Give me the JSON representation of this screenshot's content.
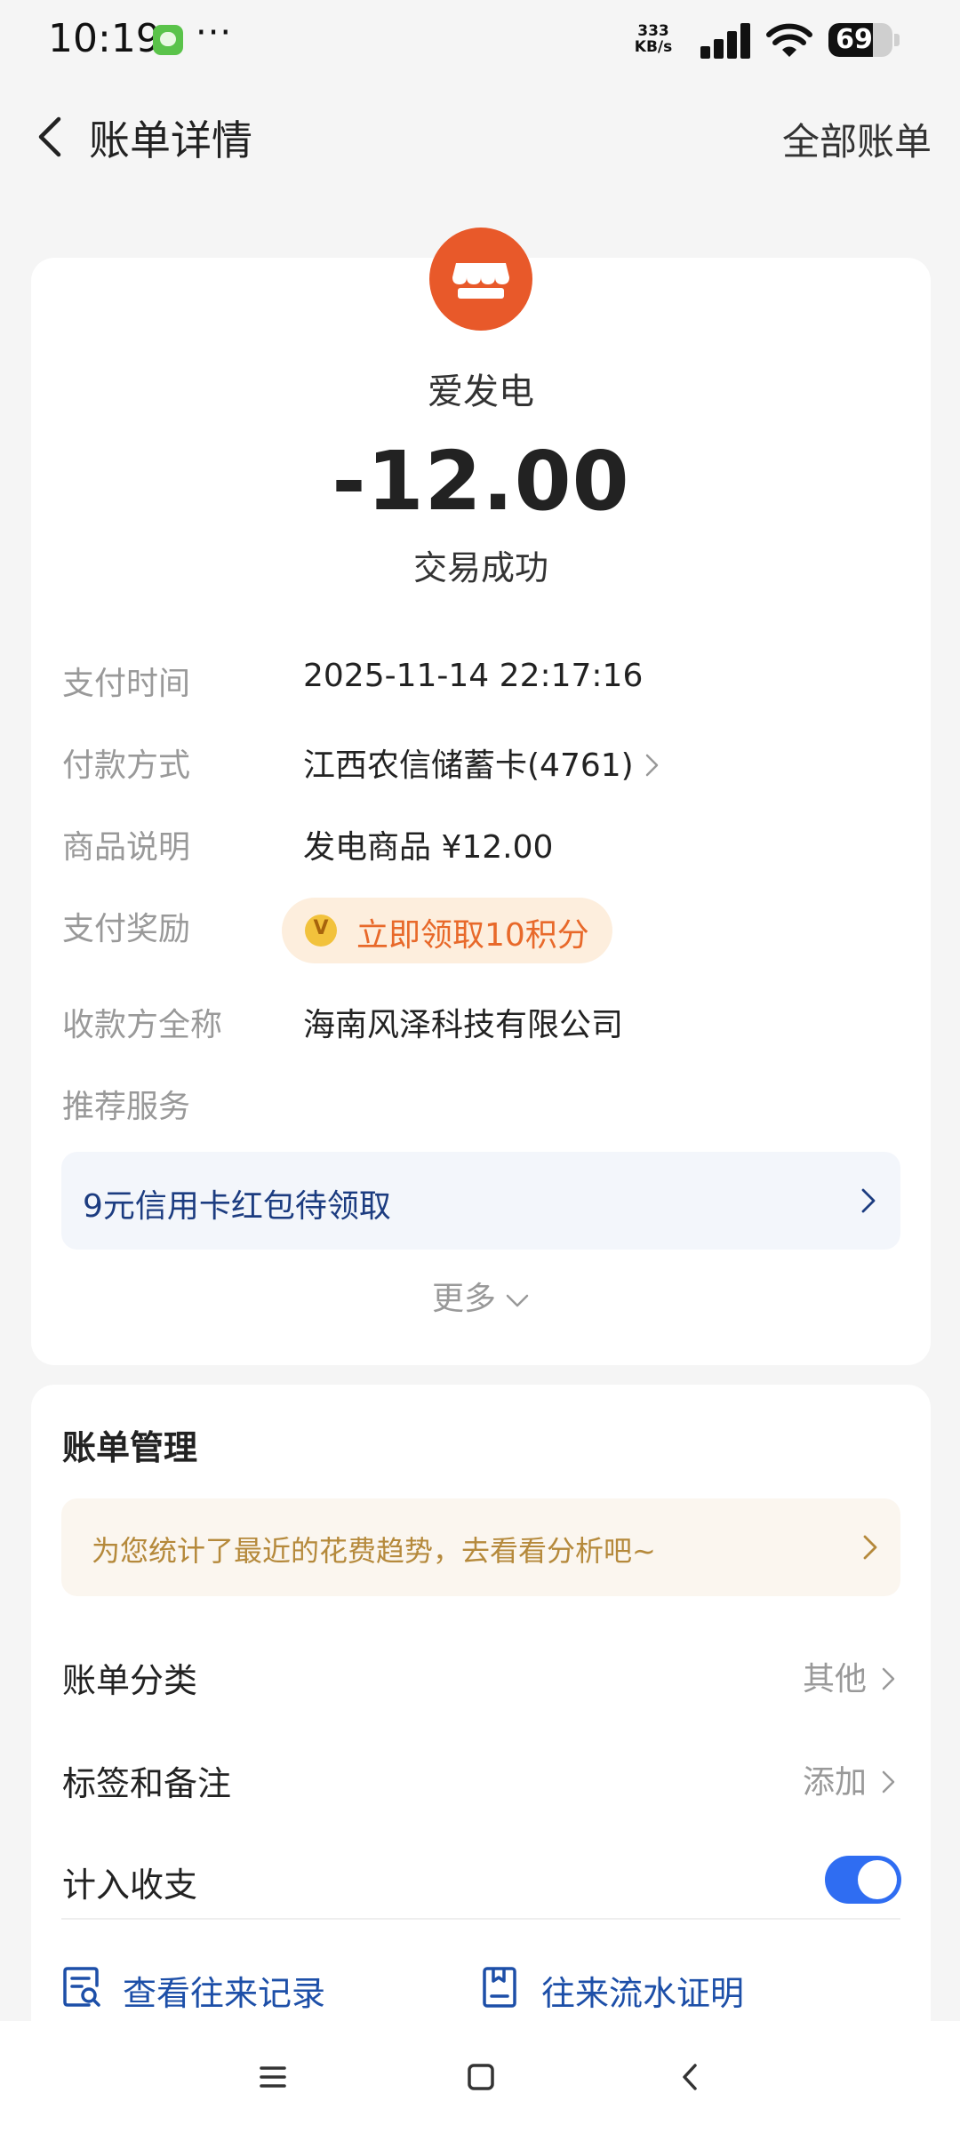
{
  "status_bar": {
    "time": "10:19",
    "network_speed_value": "333",
    "network_speed_unit": "KB/s",
    "battery": "69",
    "battery_level": 0.69
  },
  "nav": {
    "title": "账单详情",
    "right_action": "全部账单"
  },
  "transaction": {
    "merchant": "爱发电",
    "amount": "-12.00",
    "status": "交易成功",
    "details": [
      {
        "label": "支付时间",
        "value": "2025-11-14 22:17:16"
      },
      {
        "label": "付款方式",
        "value": "江西农信储蓄卡(4761)"
      },
      {
        "label": "商品说明",
        "value": "发电商品 ¥12.00"
      },
      {
        "label": "支付奖励",
        "value": "立即领取10积分"
      },
      {
        "label": "收款方全称",
        "value": "海南风泽科技有限公司"
      },
      {
        "label": "推荐服务",
        "value": ""
      }
    ],
    "promo": "9元信用卡红包待领取",
    "more": "更多"
  },
  "bill_management": {
    "title": "账单管理",
    "tip": "为您统计了最近的花费趋势，去看看分析吧~",
    "category_label": "账单分类",
    "category_value": "其他",
    "tags_label": "标签和备注",
    "tags_value": "添加",
    "include_label": "计入收支",
    "include_enabled": true,
    "links": [
      {
        "label": "查看往来记录",
        "icon": "record-search-icon"
      },
      {
        "label": "往来流水证明",
        "icon": "statement-icon"
      }
    ]
  },
  "colors": {
    "accent_blue": "#2f6df2",
    "merchant_orange": "#e8592a",
    "reward_orange": "#e8692a",
    "link_blue": "#1d4fa8",
    "tip_gold": "#b5893b"
  }
}
